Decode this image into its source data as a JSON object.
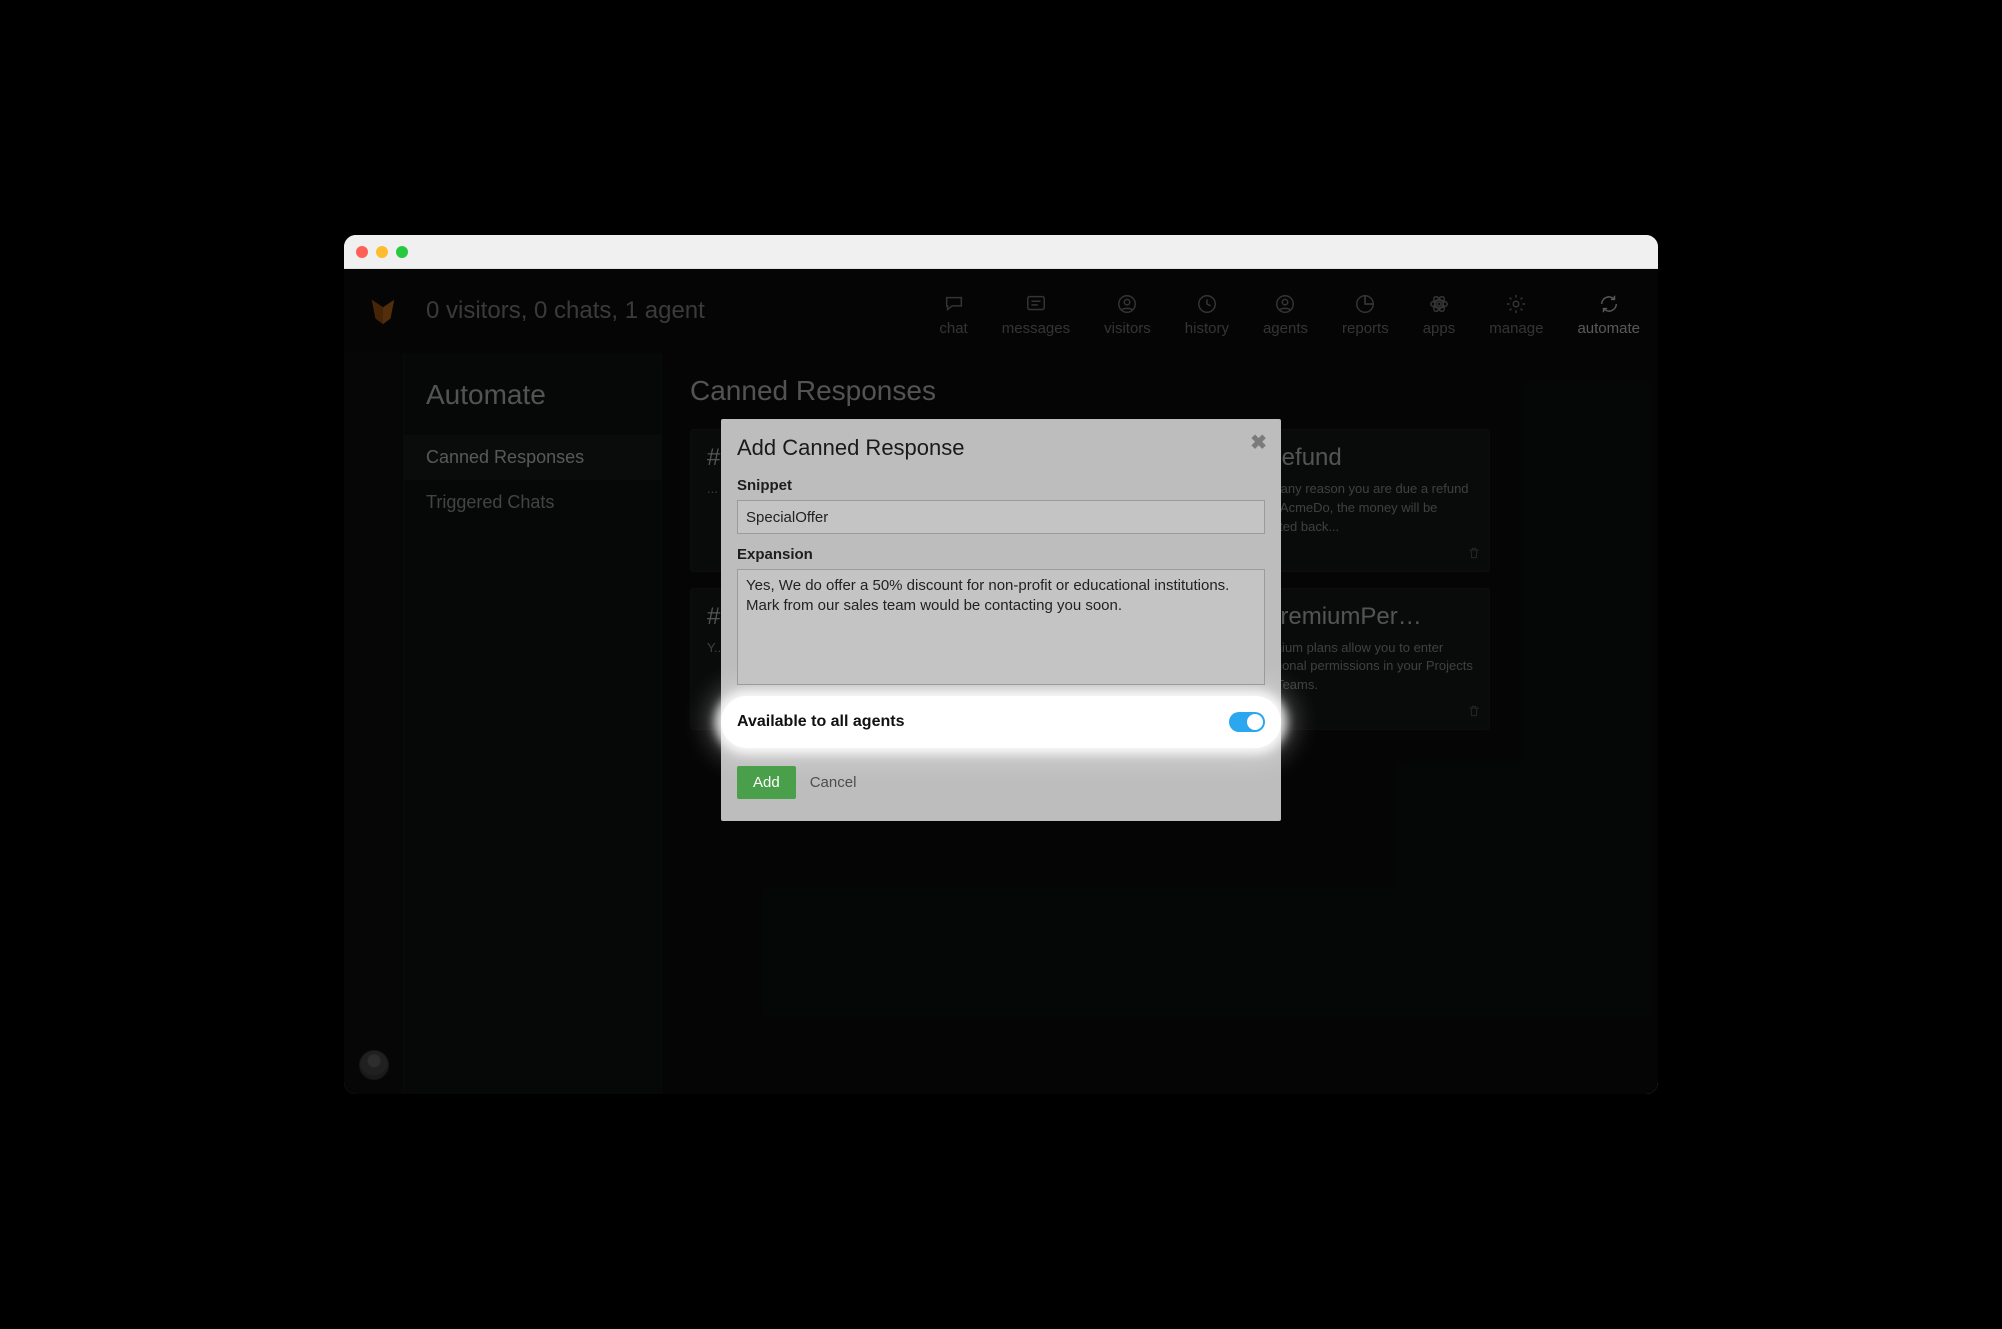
{
  "header": {
    "status_text": "0 visitors, 0 chats, 1 agent",
    "nav": [
      {
        "label": "chat",
        "icon": "chat-bubble-icon"
      },
      {
        "label": "messages",
        "icon": "message-lines-icon"
      },
      {
        "label": "visitors",
        "icon": "user-circle-icon"
      },
      {
        "label": "history",
        "icon": "clock-icon"
      },
      {
        "label": "agents",
        "icon": "user-circle-icon"
      },
      {
        "label": "reports",
        "icon": "pie-chart-icon"
      },
      {
        "label": "apps",
        "icon": "atom-icon"
      },
      {
        "label": "manage",
        "icon": "gear-icon"
      },
      {
        "label": "automate",
        "icon": "cycle-icon",
        "active": true
      }
    ]
  },
  "sidebar": {
    "title": "Automate",
    "items": [
      {
        "label": "Canned Responses",
        "active": true
      },
      {
        "label": "Triggered Chats"
      }
    ]
  },
  "main": {
    "title": "Canned Responses",
    "cards": [
      {
        "title": "#...",
        "body": "..."
      },
      {
        "title": "#...",
        "body": "..."
      },
      {
        "title": "#Refund",
        "body": "If for any reason you are due a refund from AcmeDo, the money will be credited back..."
      },
      {
        "title": "#...",
        "body": "Y...\nd...\nu..."
      },
      {
        "title": "#...",
        "body": "..."
      },
      {
        "title": "#PremiumPer…",
        "body": "Premium plans allow you to enter additional permissions in your Projects and Teams."
      }
    ]
  },
  "modal": {
    "title": "Add Canned Response",
    "snippet_label": "Snippet",
    "snippet_value": "SpecialOffer",
    "expansion_label": "Expansion",
    "expansion_value": "Yes, We do offer a 50% discount for non-profit or educational institutions. Mark from our sales team would be contacting you soon.",
    "toggle_label": "Available to all agents",
    "toggle_on": true,
    "add_label": "Add",
    "cancel_label": "Cancel"
  },
  "colors": {
    "accent_green": "#4aa04a",
    "toggle_blue": "#2aa7ef"
  }
}
